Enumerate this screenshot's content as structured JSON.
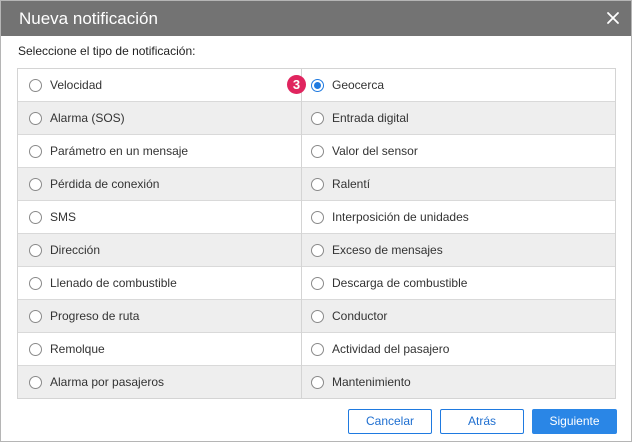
{
  "dialog": {
    "title": "Nueva notificación",
    "close_icon": "close-icon",
    "prompt": "Seleccione el tipo de notificación:",
    "step_badge": "3"
  },
  "options_left": [
    {
      "label": "Velocidad",
      "checked": false
    },
    {
      "label": "Alarma (SOS)",
      "checked": false
    },
    {
      "label": "Parámetro en un mensaje",
      "checked": false
    },
    {
      "label": "Pérdida de conexión",
      "checked": false
    },
    {
      "label": "SMS",
      "checked": false
    },
    {
      "label": "Dirección",
      "checked": false
    },
    {
      "label": "Llenado de combustible",
      "checked": false
    },
    {
      "label": "Progreso de ruta",
      "checked": false
    },
    {
      "label": "Remolque",
      "checked": false
    },
    {
      "label": "Alarma por pasajeros",
      "checked": false
    }
  ],
  "options_right": [
    {
      "label": "Geocerca",
      "checked": true
    },
    {
      "label": "Entrada digital",
      "checked": false
    },
    {
      "label": "Valor del sensor",
      "checked": false
    },
    {
      "label": "Ralentí",
      "checked": false
    },
    {
      "label": "Interposición de unidades",
      "checked": false
    },
    {
      "label": "Exceso de mensajes",
      "checked": false
    },
    {
      "label": "Descarga de combustible",
      "checked": false
    },
    {
      "label": "Conductor",
      "checked": false
    },
    {
      "label": "Actividad del pasajero",
      "checked": false
    },
    {
      "label": "Mantenimiento",
      "checked": false
    }
  ],
  "buttons": {
    "cancel": "Cancelar",
    "back": "Atrás",
    "next": "Siguiente"
  },
  "colors": {
    "titlebar": "#737373",
    "accent": "#1f7ae0",
    "badge": "#e0245e",
    "row_alt": "#eeeeee"
  }
}
